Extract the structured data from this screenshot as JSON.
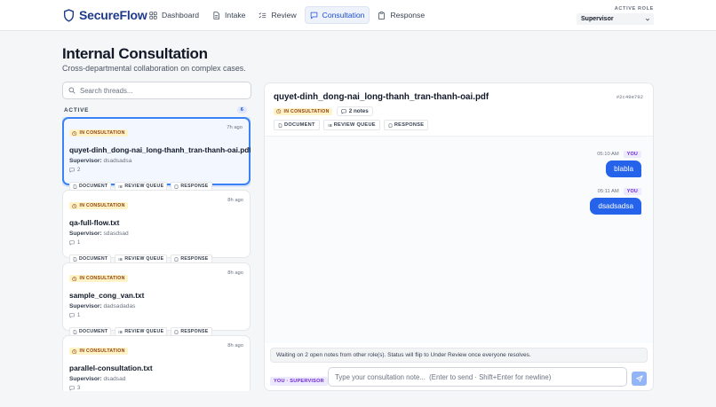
{
  "app": {
    "name": "SecureFlow"
  },
  "nav": [
    {
      "label": "Dashboard",
      "icon": "grid-icon"
    },
    {
      "label": "Intake",
      "icon": "file-icon"
    },
    {
      "label": "Review",
      "icon": "checklist-icon"
    },
    {
      "label": "Consultation",
      "icon": "chat-icon",
      "active": true
    },
    {
      "label": "Response",
      "icon": "clipboard-icon"
    }
  ],
  "role": {
    "label": "ACTIVE ROLE",
    "value": "Supervisor"
  },
  "page": {
    "title": "Internal Consultation",
    "subtitle": "Cross-departmental collaboration on complex cases."
  },
  "search": {
    "placeholder": "Search threads..."
  },
  "threads_section": {
    "label": "ACTIVE",
    "count": "6"
  },
  "threads": [
    {
      "status": "IN CONSULTATION",
      "time": "7h ago",
      "name": "quyet-dinh_dong-nai_long-thanh_tran-thanh-oai.pdf",
      "role": "Supervisor:",
      "author": "dsadsadsa",
      "notes": "2",
      "selected": true
    },
    {
      "status": "IN CONSULTATION",
      "time": "8h ago",
      "name": "qa-full-flow.txt",
      "role": "Supervisor:",
      "author": "sdasdsad",
      "notes": "1"
    },
    {
      "status": "IN CONSULTATION",
      "time": "8h ago",
      "name": "sample_cong_van.txt",
      "role": "Supervisor:",
      "author": "dadsadadas",
      "notes": "1"
    },
    {
      "status": "IN CONSULTATION",
      "time": "8h ago",
      "name": "parallel-consultation.txt",
      "role": "Supervisor:",
      "author": "dsadsad",
      "notes": "3"
    }
  ],
  "thread_actions": {
    "document": "DOCUMENT",
    "review_queue": "REVIEW QUEUE",
    "response": "RESPONSE"
  },
  "detail": {
    "title": "quyet-dinh_dong-nai_long-thanh_tran-thanh-oai.pdf",
    "hash": "#2c49e792",
    "status": "IN CONSULTATION",
    "notes": "2 notes",
    "messages": [
      {
        "time": "05:10 AM",
        "badge": "YOU",
        "text": "blabla"
      },
      {
        "time": "05:11 AM",
        "badge": "YOU",
        "text": "dsadsadsa"
      }
    ],
    "waiting": "Waiting on 2 open notes from other role(s). Status will flip to Under Review once everyone resolves.",
    "composer_badge": "YOU · SUPERVISOR",
    "composer_placeholder": "Type your consultation note...  (Enter to send · Shift+Enter for newline)"
  },
  "colors": {
    "brand": "#1e3a8a",
    "accent": "#2563eb",
    "status_bg": "#fef3c7",
    "status_text": "#92400e",
    "you_badge": "#6d28d9"
  }
}
